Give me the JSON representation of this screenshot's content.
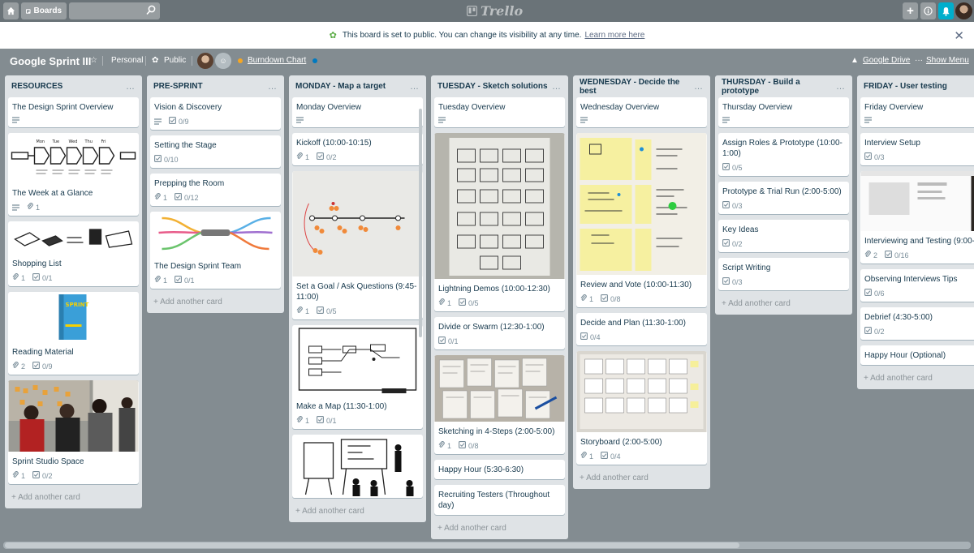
{
  "topbar": {
    "boards_label": "Boards",
    "search_placeholder": "",
    "logo": "Trello"
  },
  "notice": {
    "text": "This board is set to public. You can change its visibility at any time.",
    "link": "Learn more here"
  },
  "board": {
    "title": "Google Sprint III",
    "team": "Personal",
    "visibility": "Public",
    "powerup": "Burndown Chart",
    "drive": "Google Drive",
    "show_menu": "Show Menu"
  },
  "add_card_label": "+ Add another card",
  "lists": [
    {
      "title": "RESOURCES",
      "cards": [
        {
          "title": "The Design Sprint Overview",
          "desc": true
        },
        {
          "title": "The Week at a Glance",
          "cover": "sketch-strip",
          "desc": true,
          "attach": "1"
        },
        {
          "title": "Shopping List",
          "cover": "devices",
          "attach": "1",
          "check": "0/1"
        },
        {
          "title": "Reading Material",
          "cover": "book",
          "attach": "2",
          "check": "0/9"
        },
        {
          "title": "Sprint Studio Space",
          "cover": "people",
          "attach": "1",
          "check": "0/2"
        }
      ]
    },
    {
      "title": "PRE-SPRINT",
      "cards": [
        {
          "title": "Vision & Discovery",
          "desc": true,
          "check": "0/9"
        },
        {
          "title": "Setting the Stage",
          "check": "0/10"
        },
        {
          "title": "Prepping the Room",
          "attach": "1",
          "check": "0/12"
        },
        {
          "title": "The Design Sprint Team",
          "cover": "mindmap",
          "attach": "1",
          "check": "0/1"
        }
      ]
    },
    {
      "title": "MONDAY - Map a target",
      "cards": [
        {
          "title": "Monday Overview",
          "desc": true
        },
        {
          "title": "Kickoff (10:00-10:15)",
          "attach": "1",
          "check": "0/2"
        },
        {
          "title": "Set a Goal / Ask Questions (9:45-11:00)",
          "cover": "whiteboard-dots",
          "attach": "1",
          "check": "0/5"
        },
        {
          "title": "Make a Map (11:30-1:00)",
          "cover": "map-sketch",
          "attach": "1",
          "check": "0/1"
        },
        {
          "title": "",
          "cover": "people-sketch"
        }
      ]
    },
    {
      "title": "TUESDAY - Sketch solutions",
      "cards": [
        {
          "title": "Tuesday Overview",
          "desc": true
        },
        {
          "title": "Lightning Demos (10:00-12:30)",
          "cover": "whiteboard-grid",
          "attach": "1",
          "check": "0/5"
        },
        {
          "title": "Divide or Swarm (12:30-1:00)",
          "check": "0/1"
        },
        {
          "title": "Sketching in 4-Steps (2:00-5:00)",
          "cover": "papers",
          "attach": "1",
          "check": "0/8"
        },
        {
          "title": "Happy Hour (5:30-6:30)"
        },
        {
          "title": "Recruiting Testers (Throughout day)"
        }
      ]
    },
    {
      "title": "WEDNESDAY - Decide the best",
      "cards": [
        {
          "title": "Wednesday Overview",
          "desc": true
        },
        {
          "title": "Review and Vote (10:00-11:30)",
          "cover": "sticky-notes",
          "attach": "1",
          "check": "0/8"
        },
        {
          "title": "Decide and Plan (11:30-1:00)",
          "check": "0/4"
        },
        {
          "title": "Storyboard (2:00-5:00)",
          "cover": "storyboard",
          "attach": "1",
          "check": "0/4"
        }
      ]
    },
    {
      "title": "THURSDAY - Build a prototype",
      "cards": [
        {
          "title": "Thursday Overview",
          "desc": true
        },
        {
          "title": "Assign Roles & Prototype (10:00-1:00)",
          "check": "0/5"
        },
        {
          "title": "Prototype & Trial Run (2:00-5:00)",
          "check": "0/3"
        },
        {
          "title": "Key Ideas",
          "check": "0/2"
        },
        {
          "title": "Script Writing",
          "check": "0/3"
        }
      ]
    },
    {
      "title": "FRIDAY - User testing",
      "cards": [
        {
          "title": "Friday Overview",
          "desc": true
        },
        {
          "title": "Interview Setup",
          "check": "0/3"
        },
        {
          "title": "Interviewing and Testing (9:00-4:0",
          "cover": "video-call",
          "attach": "2",
          "check": "0/16"
        },
        {
          "title": "Observing Interviews Tips",
          "check": "0/6"
        },
        {
          "title": "Debrief (4:30-5:00)",
          "check": "0/2"
        },
        {
          "title": "Happy Hour (Optional)"
        }
      ]
    }
  ]
}
